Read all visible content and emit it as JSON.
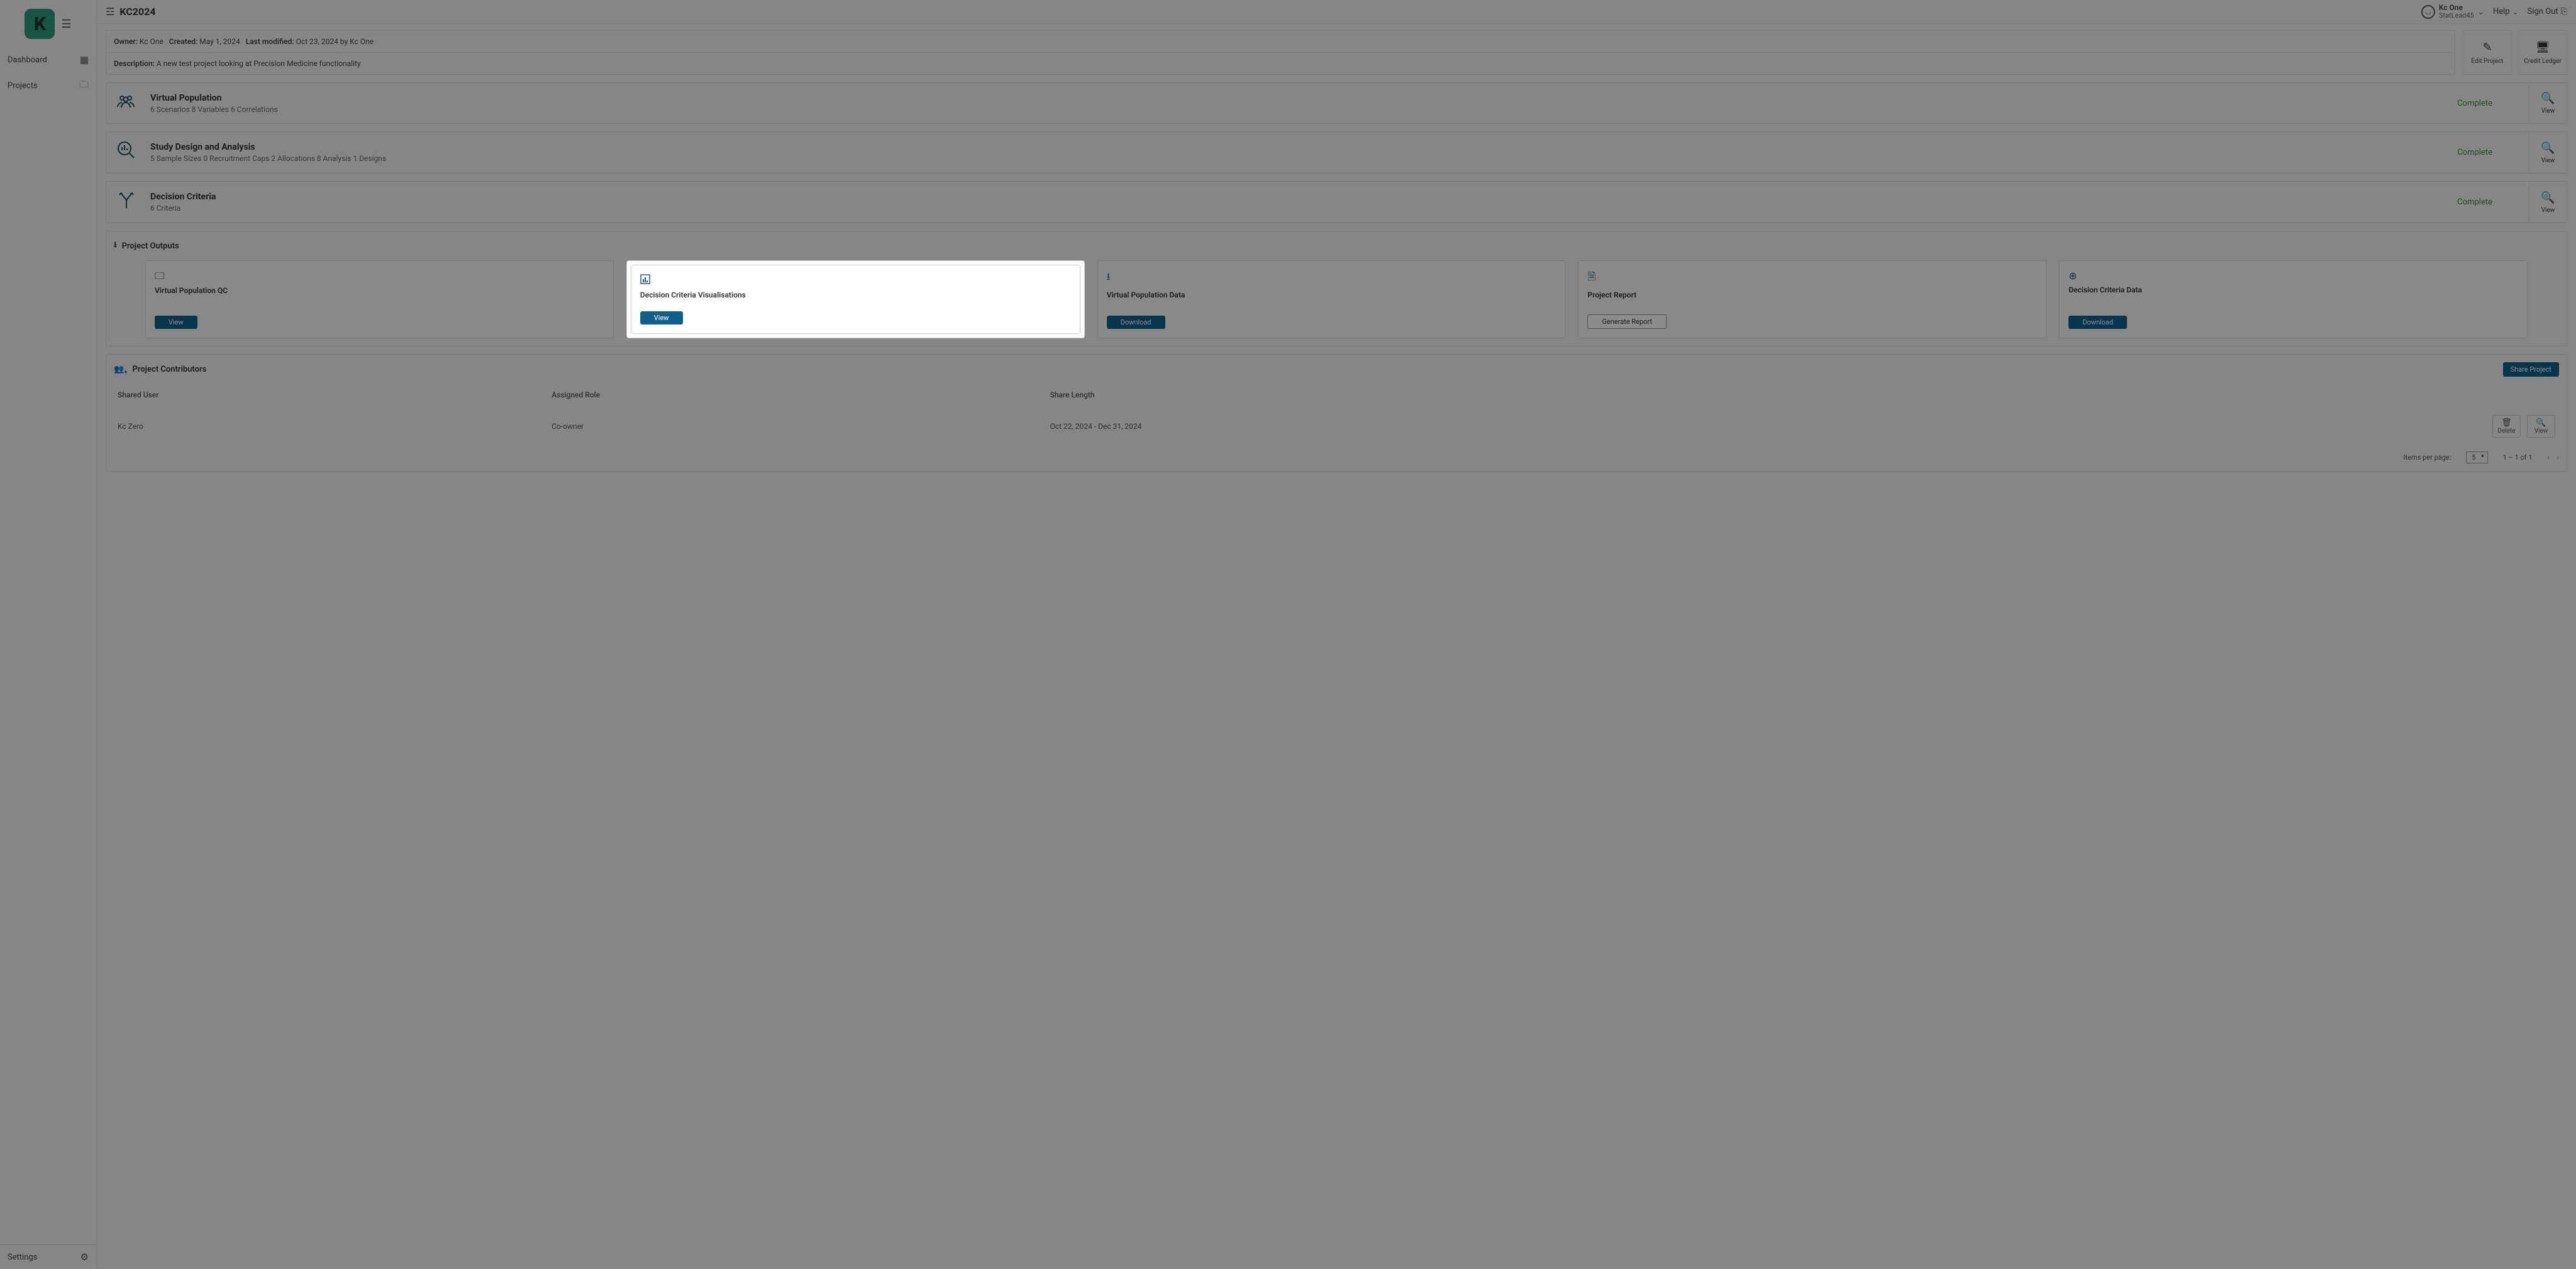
{
  "sidebar": {
    "logo_letter": "K",
    "items": [
      {
        "label": "Dashboard",
        "icon": "dashboard"
      },
      {
        "label": "Projects",
        "icon": "folder"
      }
    ],
    "settings_label": "Settings"
  },
  "header": {
    "title": "KC2024",
    "user_name": "Kc One",
    "user_role": "StatLead45",
    "help_label": "Help",
    "signout_label": "Sign Out"
  },
  "project_meta": {
    "owner_label": "Owner:",
    "owner_value": "Kc One",
    "created_label": "Created:",
    "created_value": "May 1, 2024",
    "modified_label": "Last modified:",
    "modified_value": "Oct 23, 2024 by Kc One",
    "description_label": "Description:",
    "description_value": "A new test project looking at Precision Medicine functionality",
    "edit_project_label": "Edit Project",
    "credit_ledger_label": "Credit Ledger"
  },
  "sections": [
    {
      "title": "Virtual Population",
      "sub": "6 Scenarios   8 Variables   6 Correlations",
      "status": "Complete",
      "view": "View",
      "icon": "people"
    },
    {
      "title": "Study Design and Analysis",
      "sub": "5 Sample Sizes   0 Recruitment Caps   2 Allocations   8 Analysis   1 Designs",
      "status": "Complete",
      "view": "View",
      "icon": "search-chart"
    },
    {
      "title": "Decision Criteria",
      "sub": "6 Criteria",
      "status": "Complete",
      "view": "View",
      "icon": "split"
    }
  ],
  "outputs": {
    "header": "Project Outputs",
    "tiles": [
      {
        "title": "Virtual Population QC",
        "action": "View",
        "btn_style": "primary",
        "icon": "monitor"
      },
      {
        "title": "Decision Criteria Visualisations",
        "action": "View",
        "btn_style": "primary",
        "icon": "bar-chart",
        "highlighted": true
      },
      {
        "title": "Virtual Population Data",
        "action": "Download",
        "btn_style": "primary",
        "icon": "download"
      },
      {
        "title": "Project Report",
        "action": "Generate Report",
        "btn_style": "outline",
        "icon": "document"
      },
      {
        "title": "Decision Criteria Data",
        "action": "Download",
        "btn_style": "primary",
        "icon": "download-circle"
      }
    ]
  },
  "contributors": {
    "header": "Project Contributors",
    "share_btn": "Share Project",
    "columns": {
      "user": "Shared User",
      "role": "Assigned Role",
      "length": "Share Length"
    },
    "rows": [
      {
        "user": "Kc Zero",
        "role": "Co-owner",
        "length": "Oct 22, 2024 - Dec 31, 2024",
        "delete": "Delete",
        "view": "View"
      }
    ],
    "items_per_page_label": "Items per page:",
    "items_per_page_value": "5",
    "range_text": "1 – 1 of 1"
  }
}
